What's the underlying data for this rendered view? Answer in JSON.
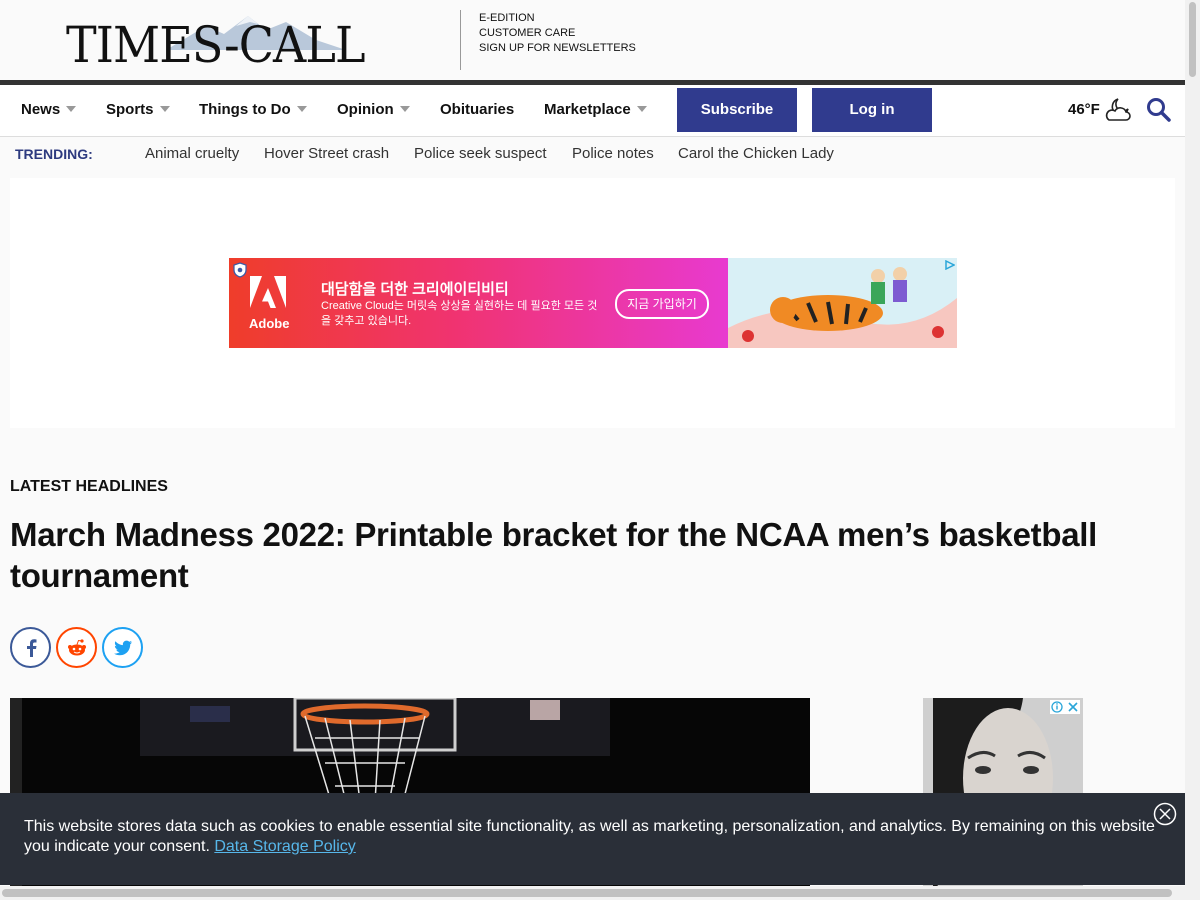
{
  "header": {
    "logo_text": "TIMES-CALL",
    "links": [
      "E-EDITION",
      "CUSTOMER CARE",
      "SIGN UP FOR NEWSLETTERS"
    ]
  },
  "nav": {
    "items": [
      {
        "label": "News",
        "dropdown": true
      },
      {
        "label": "Sports",
        "dropdown": true
      },
      {
        "label": "Things to Do",
        "dropdown": true
      },
      {
        "label": "Opinion",
        "dropdown": true
      },
      {
        "label": "Obituaries",
        "dropdown": false
      },
      {
        "label": "Marketplace",
        "dropdown": true
      }
    ],
    "subscribe_label": "Subscribe",
    "login_label": "Log in",
    "weather_temp": "46°F",
    "weather_icon": "partly-cloudy-night-icon",
    "search_icon": "search-icon",
    "accent_color": "#303b8e"
  },
  "trending": {
    "label": "TRENDING:",
    "links": [
      "Animal cruelty",
      "Hover Street crash",
      "Police seek suspect",
      "Police notes",
      "Carol the Chicken Lady"
    ]
  },
  "ad_banner": {
    "brand": "Adobe",
    "headline": "대담함을 더한 크리에이티비티",
    "subtext": "Creative Cloud는 머릿속 상상을 실현하는 데 필요한 모든 것을 갖추고 있습니다.",
    "cta": "지금 가입하기"
  },
  "article": {
    "section_label": "LATEST HEADLINES",
    "headline": "March Madness 2022: Printable bracket for the NCAA men’s basketball tournament",
    "share": [
      {
        "name": "facebook",
        "icon": "facebook-icon",
        "color": "#3b5998"
      },
      {
        "name": "reddit",
        "icon": "reddit-icon",
        "color": "#ff4500"
      },
      {
        "name": "twitter",
        "icon": "twitter-icon",
        "color": "#1da1f2"
      }
    ]
  },
  "cookie_banner": {
    "text": "This website stores data such as cookies to enable essential site functionality, as well as marketing, personalization, and analytics. By remaining on this website you indicate your consent.",
    "link_text": "Data Storage Policy"
  }
}
